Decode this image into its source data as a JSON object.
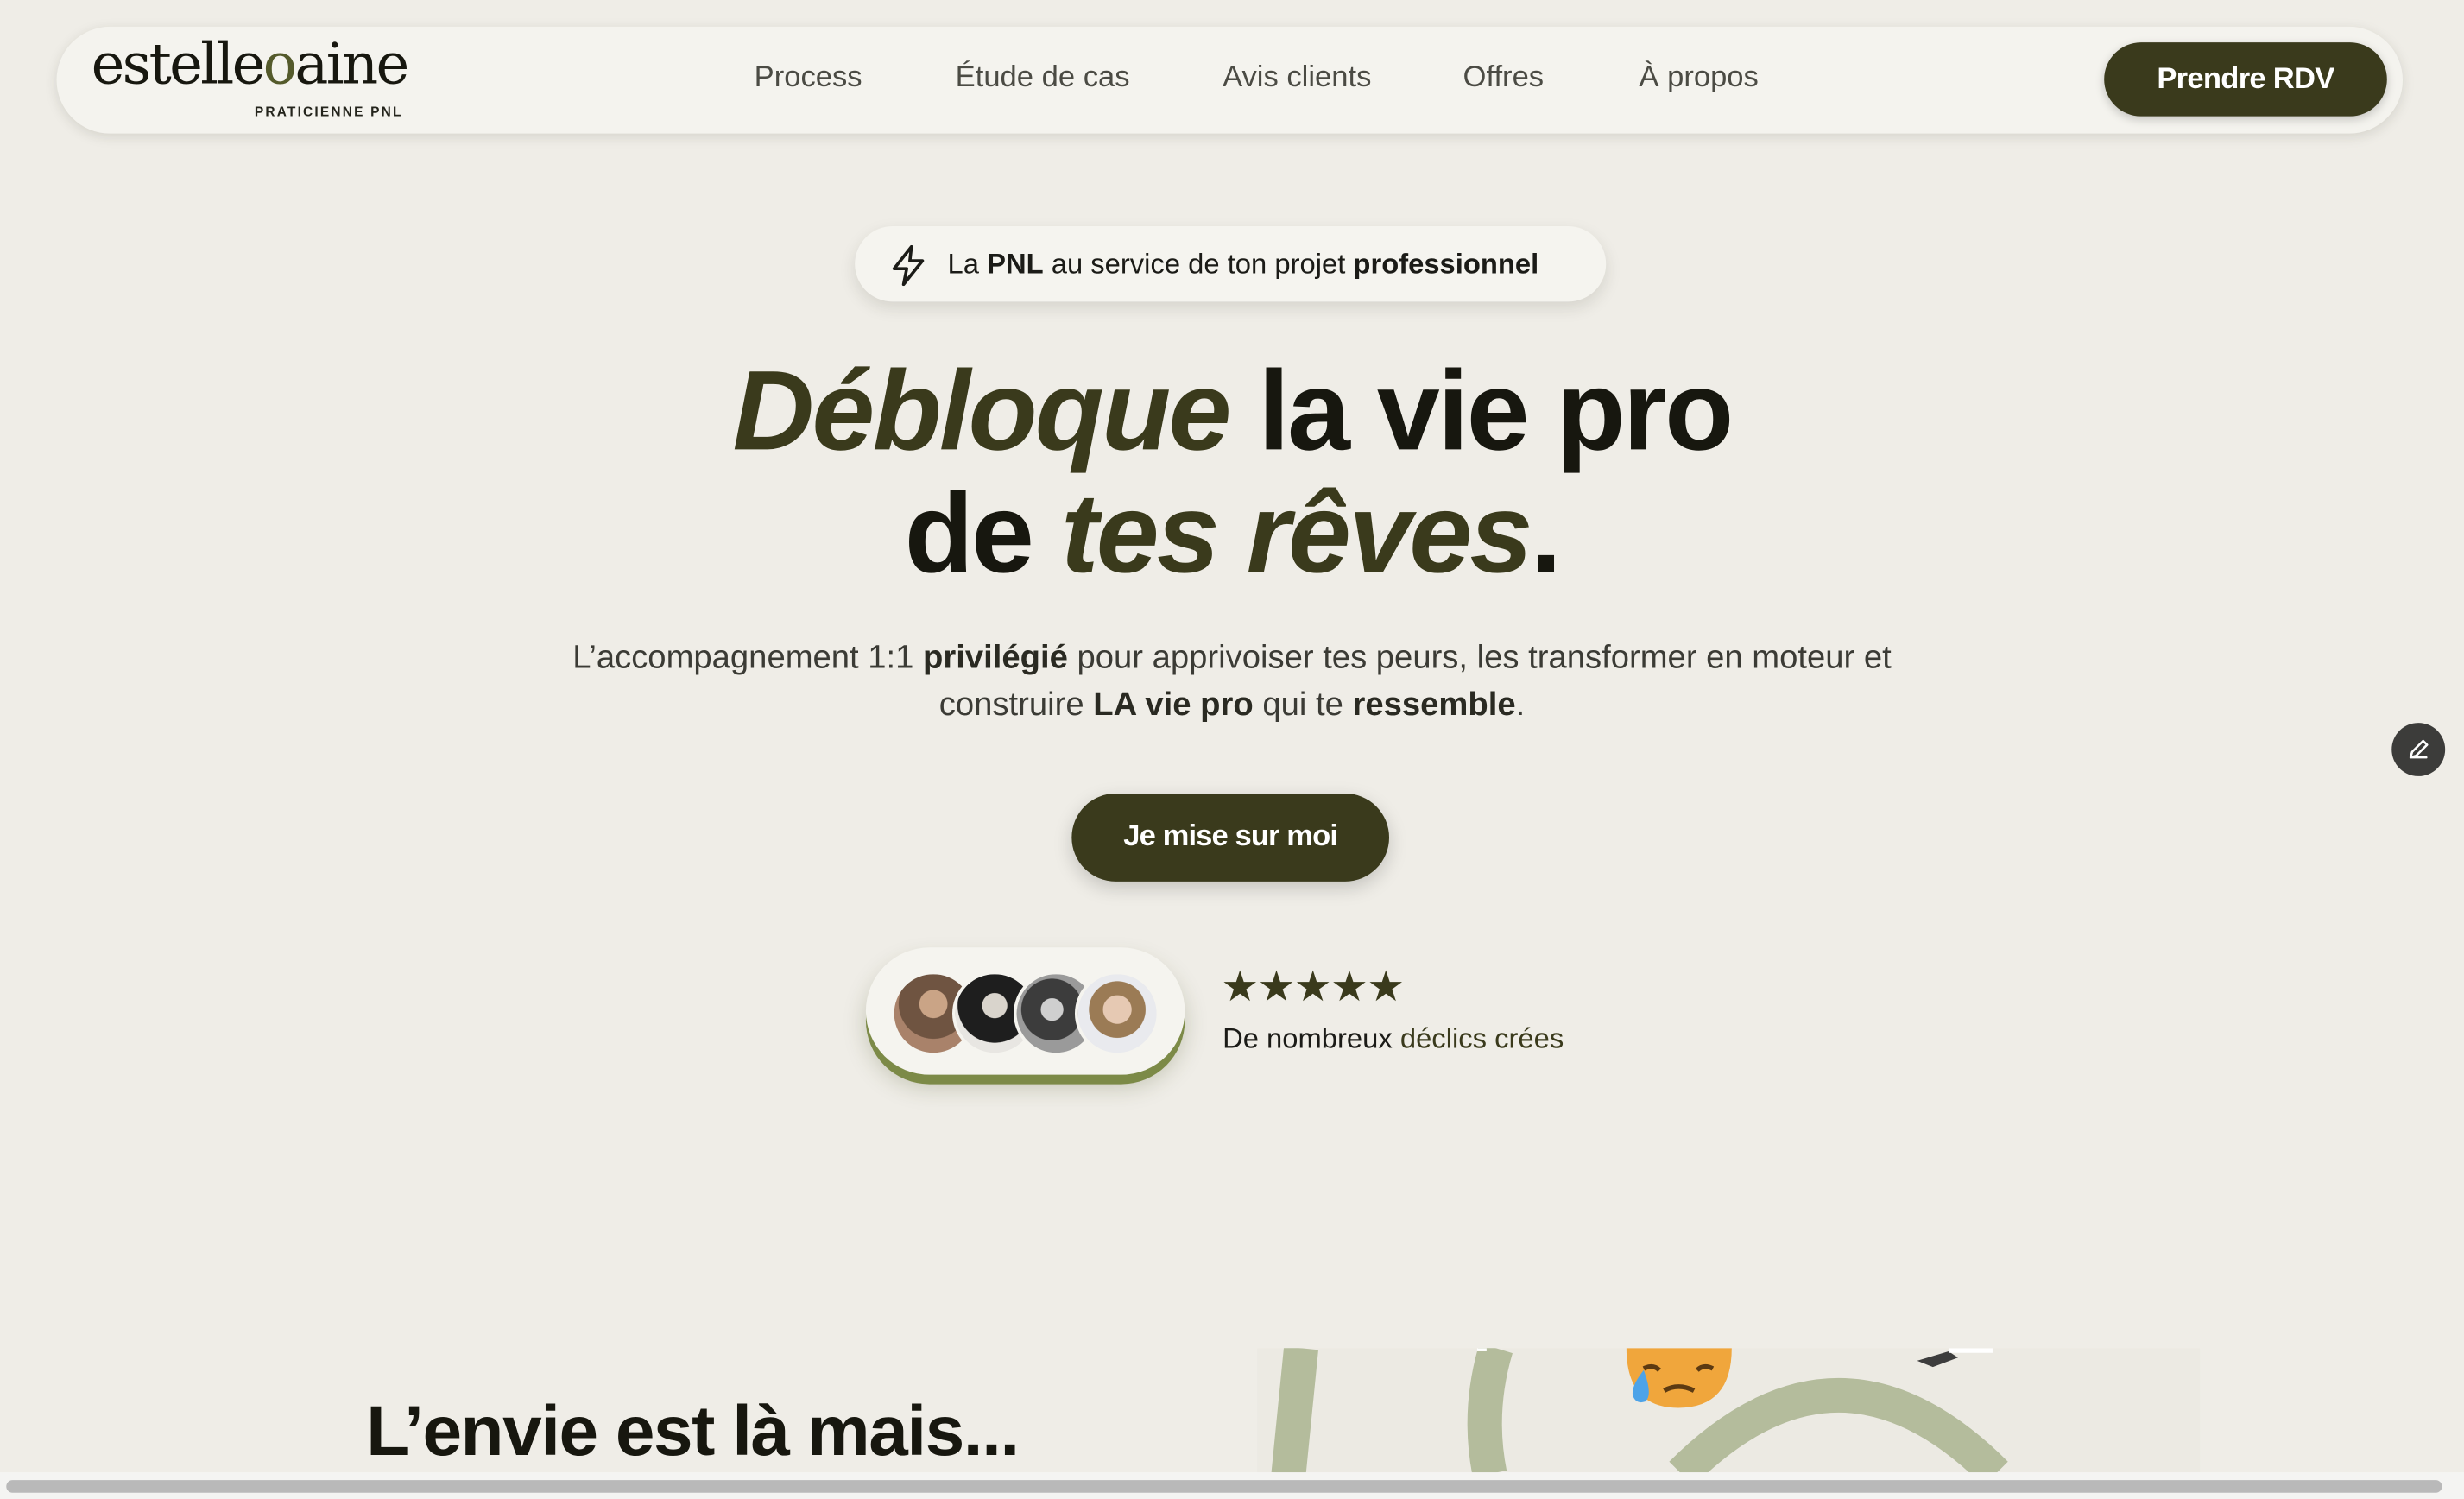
{
  "header": {
    "logo": {
      "left": "estelle",
      "accent": "o",
      "right": "aine",
      "tagline": "PRATICIENNE PNL"
    },
    "nav": [
      "Process",
      "Étude de cas",
      "Avis clients",
      "Offres",
      "À propos"
    ],
    "cta_label": "Prendre RDV"
  },
  "hero": {
    "badge": {
      "icon": "lightning-icon",
      "t1": "La ",
      "b1": "PNL",
      "t2": " au service de ton projet ",
      "b2": "professionnel"
    },
    "headline": {
      "line1_italic": "Débloque",
      "line1_rest": " la vie pro",
      "line2_start": "de ",
      "line2_italic": "tes rêves",
      "line2_end": "."
    },
    "subtitle": {
      "l1a": "L’accompagnement 1:1 ",
      "l1b": "privilégié",
      "l1c": " pour apprivoiser tes peurs, les transformer en moteur et",
      "l2a": "construire ",
      "l2b": "LA vie pro",
      "l2c": " qui te ",
      "l2d": "ressemble",
      "l2e": "."
    },
    "cta_label": "Je mise sur moi"
  },
  "social_proof": {
    "rating": 5,
    "stars": "★★★★★",
    "text_start": "De nombreux ",
    "text_accent": "déclics crées"
  },
  "section": {
    "title": "L’envie est là mais..."
  },
  "colors": {
    "background": "#efede7",
    "dark_olive": "#3a3a1c",
    "olive_accent": "#7c8a47",
    "sage": "#b4bc9c"
  },
  "icons": {
    "edit": "pencil-icon",
    "emoji": "sweating-face-emoji-icon"
  }
}
